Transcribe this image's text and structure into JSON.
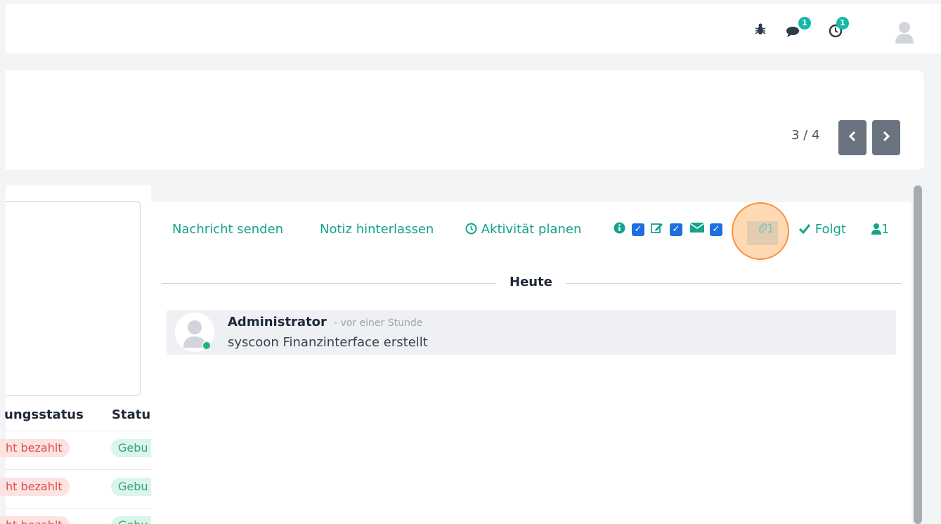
{
  "topbar": {
    "bug_icon": "bug-icon",
    "chat_icon": "comments-icon",
    "chat_badge": "1",
    "activity_icon": "clock-icon",
    "activity_badge": "1",
    "user_icon": "user-avatar"
  },
  "pager": {
    "text": "3 / 4",
    "prev_icon": "chevron-left-icon",
    "next_icon": "chevron-right-icon"
  },
  "table": {
    "headers": [
      "ungsstatus",
      "Statu"
    ],
    "rows": [
      {
        "payment": "ht bezahlt",
        "status": "Gebu"
      },
      {
        "payment": "ht bezahlt",
        "status": "Gebu"
      },
      {
        "payment": "ht bezahlt",
        "status": "Gebu"
      }
    ]
  },
  "chatter": {
    "send_message": "Nachricht senden",
    "log_note": "Notiz hinterlassen",
    "schedule_activity": "Aktivität planen",
    "attachments_count": "1",
    "follow_label": "Folgt",
    "followers_count": "1",
    "separator": "Heute",
    "message": {
      "author": "Administrator",
      "time": "- vor einer Stunde",
      "body": "syscoon Finanzinterface erstellt"
    }
  },
  "colors": {
    "accent": "#14a38b",
    "badge": "#14b8a6",
    "checkbox": "#1d6fe0",
    "highlight": "#fb923c"
  }
}
